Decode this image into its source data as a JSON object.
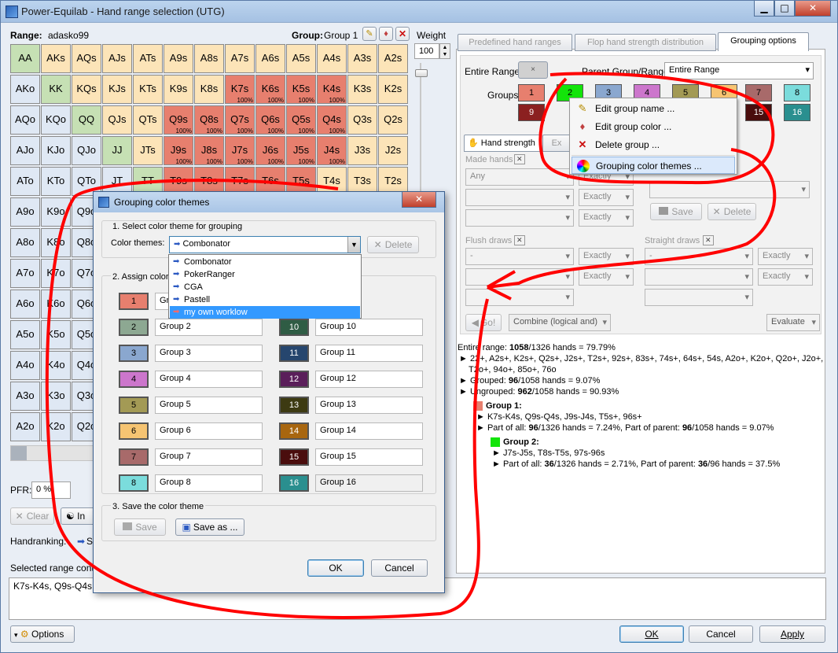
{
  "window": {
    "title": "Power-Equilab - Hand range selection (UTG)",
    "min": "▁",
    "max": "□",
    "close": "✕"
  },
  "range": {
    "label": "Range:",
    "name": "adasko99"
  },
  "group": {
    "label": "Group:",
    "name": "Group 1",
    "weight_label": "Weight",
    "weight_value": "100"
  },
  "grid": {
    "rows": [
      [
        {
          "t": "AA",
          "c": "#c6e0b4"
        },
        {
          "t": "AKs",
          "c": "#fce4b8"
        },
        {
          "t": "AQs",
          "c": "#fce4b8"
        },
        {
          "t": "AJs",
          "c": "#fce4b8"
        },
        {
          "t": "ATs",
          "c": "#fce4b8"
        },
        {
          "t": "A9s",
          "c": "#fce4b8"
        },
        {
          "t": "A8s",
          "c": "#fce4b8"
        },
        {
          "t": "A7s",
          "c": "#fce4b8"
        },
        {
          "t": "A6s",
          "c": "#fce4b8"
        },
        {
          "t": "A5s",
          "c": "#fce4b8"
        },
        {
          "t": "A4s",
          "c": "#fce4b8"
        },
        {
          "t": "A3s",
          "c": "#fce4b8"
        },
        {
          "t": "A2s",
          "c": "#fce4b8"
        }
      ],
      [
        {
          "t": "AKo",
          "c": "#dfe8f4"
        },
        {
          "t": "KK",
          "c": "#c6e0b4"
        },
        {
          "t": "KQs",
          "c": "#fce4b8"
        },
        {
          "t": "KJs",
          "c": "#fce4b8"
        },
        {
          "t": "KTs",
          "c": "#fce4b8"
        },
        {
          "t": "K9s",
          "c": "#fce4b8"
        },
        {
          "t": "K8s",
          "c": "#fce4b8"
        },
        {
          "t": "K7s",
          "c": "#e77f6e",
          "p": "100%"
        },
        {
          "t": "K6s",
          "c": "#e77f6e",
          "p": "100%"
        },
        {
          "t": "K5s",
          "c": "#e77f6e",
          "p": "100%"
        },
        {
          "t": "K4s",
          "c": "#e77f6e",
          "p": "100%"
        },
        {
          "t": "K3s",
          "c": "#fce4b8"
        },
        {
          "t": "K2s",
          "c": "#fce4b8"
        }
      ],
      [
        {
          "t": "AQo",
          "c": "#dfe8f4"
        },
        {
          "t": "KQo",
          "c": "#dfe8f4"
        },
        {
          "t": "QQ",
          "c": "#c6e0b4"
        },
        {
          "t": "QJs",
          "c": "#fce4b8"
        },
        {
          "t": "QTs",
          "c": "#fce4b8"
        },
        {
          "t": "Q9s",
          "c": "#e77f6e",
          "p": "100%"
        },
        {
          "t": "Q8s",
          "c": "#e77f6e",
          "p": "100%"
        },
        {
          "t": "Q7s",
          "c": "#e77f6e",
          "p": "100%"
        },
        {
          "t": "Q6s",
          "c": "#e77f6e",
          "p": "100%"
        },
        {
          "t": "Q5s",
          "c": "#e77f6e",
          "p": "100%"
        },
        {
          "t": "Q4s",
          "c": "#e77f6e",
          "p": "100%"
        },
        {
          "t": "Q3s",
          "c": "#fce4b8"
        },
        {
          "t": "Q2s",
          "c": "#fce4b8"
        }
      ],
      [
        {
          "t": "AJo",
          "c": "#dfe8f4"
        },
        {
          "t": "KJo",
          "c": "#dfe8f4"
        },
        {
          "t": "QJo",
          "c": "#dfe8f4"
        },
        {
          "t": "JJ",
          "c": "#c6e0b4"
        },
        {
          "t": "JTs",
          "c": "#fce4b8"
        },
        {
          "t": "J9s",
          "c": "#e77f6e",
          "p": "100%"
        },
        {
          "t": "J8s",
          "c": "#e77f6e",
          "p": "100%"
        },
        {
          "t": "J7s",
          "c": "#e77f6e",
          "p": "100%"
        },
        {
          "t": "J6s",
          "c": "#e77f6e",
          "p": "100%"
        },
        {
          "t": "J5s",
          "c": "#e77f6e",
          "p": "100%"
        },
        {
          "t": "J4s",
          "c": "#e77f6e",
          "p": "100%"
        },
        {
          "t": "J3s",
          "c": "#fce4b8"
        },
        {
          "t": "J2s",
          "c": "#fce4b8"
        }
      ],
      [
        {
          "t": "ATo",
          "c": "#dfe8f4"
        },
        {
          "t": "KTo",
          "c": "#dfe8f4"
        },
        {
          "t": "QTo",
          "c": "#dfe8f4"
        },
        {
          "t": "JT",
          "c": "#dfe8f4"
        },
        {
          "t": "TT",
          "c": "#c6e0b4"
        },
        {
          "t": "T9s",
          "c": "#e77f6e"
        },
        {
          "t": "T8s",
          "c": "#e77f6e"
        },
        {
          "t": "T7s",
          "c": "#e77f6e"
        },
        {
          "t": "T6s",
          "c": "#e77f6e"
        },
        {
          "t": "T5s",
          "c": "#e77f6e"
        },
        {
          "t": "T4s",
          "c": "#fce4b8"
        },
        {
          "t": "T3s",
          "c": "#fce4b8"
        },
        {
          "t": "T2s",
          "c": "#fce4b8"
        }
      ],
      [
        {
          "t": "A9o",
          "c": "#dfe8f4"
        },
        {
          "t": "K9o",
          "c": "#dfe8f4"
        },
        {
          "t": "Q9o",
          "c": "#dfe8f4"
        }
      ],
      [
        {
          "t": "A8o",
          "c": "#dfe8f4"
        },
        {
          "t": "K8o",
          "c": "#dfe8f4"
        },
        {
          "t": "Q8o",
          "c": "#dfe8f4"
        }
      ],
      [
        {
          "t": "A7o",
          "c": "#dfe8f4"
        },
        {
          "t": "K7o",
          "c": "#dfe8f4"
        },
        {
          "t": "Q7o",
          "c": "#dfe8f4"
        }
      ],
      [
        {
          "t": "A6o",
          "c": "#dfe8f4"
        },
        {
          "t": "K6o",
          "c": "#dfe8f4"
        },
        {
          "t": "Q6o",
          "c": "#dfe8f4"
        }
      ],
      [
        {
          "t": "A5o",
          "c": "#dfe8f4"
        },
        {
          "t": "K5o",
          "c": "#dfe8f4"
        },
        {
          "t": "Q5o",
          "c": "#dfe8f4"
        }
      ],
      [
        {
          "t": "A4o",
          "c": "#dfe8f4"
        },
        {
          "t": "K4o",
          "c": "#dfe8f4"
        },
        {
          "t": "Q4o",
          "c": "#dfe8f4"
        }
      ],
      [
        {
          "t": "A3o",
          "c": "#dfe8f4"
        },
        {
          "t": "K3o",
          "c": "#dfe8f4"
        },
        {
          "t": "Q3o",
          "c": "#dfe8f4"
        }
      ],
      [
        {
          "t": "A2o",
          "c": "#dfe8f4"
        },
        {
          "t": "K2o",
          "c": "#dfe8f4"
        },
        {
          "t": "Q2o",
          "c": "#dfe8f4"
        }
      ]
    ]
  },
  "left_bottom": {
    "pfr_label": "PFR:",
    "pfr_value": "0",
    "pfr_unit": "%",
    "clear": "Clear",
    "in": "In",
    "handranking": "Handranking:",
    "s": "S",
    "selected": "Selected range contai",
    "range_text": "K7s-K4s, Q9s-Q4s, J",
    "options": "Options"
  },
  "tabs": {
    "predefined": "Predefined hand ranges",
    "flop": "Flop hand strength distribution",
    "grouping": "Grouping options"
  },
  "grouping": {
    "entire_range_label": "Entire Range:",
    "entire_btn": "×",
    "parent_label": "Parent Group/Range:",
    "parent_value": "Entire Range",
    "groups_label": "Groups:",
    "buttons": [
      {
        "n": "1",
        "c": "#e77f6e"
      },
      {
        "n": "2",
        "c": "#13e40a"
      },
      {
        "n": "3",
        "c": "#8aa7cf"
      },
      {
        "n": "4",
        "c": "#cc76cc"
      },
      {
        "n": "5",
        "c": "#a39a55"
      },
      {
        "n": "6",
        "c": "#f6c472"
      },
      {
        "n": "7",
        "c": "#a86a6a"
      },
      {
        "n": "8",
        "c": "#7bdcdc"
      },
      {
        "n": "9",
        "c": "#8b2020"
      },
      {
        "n": "15",
        "c": "#4a0d0d"
      },
      {
        "n": "16",
        "c": "#2a8f8f"
      }
    ]
  },
  "menu": {
    "items": [
      "Edit group name ...",
      "Edit group color ...",
      "Delete group ...",
      "Grouping color themes ..."
    ]
  },
  "subtabs": {
    "hand_strength": "Hand strength",
    "ex": "Ex"
  },
  "filters": {
    "made_hands": "Made hands",
    "any": "Any",
    "exactly": "Exactly",
    "save": "Save",
    "delete": "Delete",
    "flush": "Flush draws",
    "straight": "Straight draws",
    "dash": "-",
    "go": "Go!",
    "combine": "Combine (logical and)",
    "evaluate": "Evaluate"
  },
  "info": {
    "l1a": "Entire range: ",
    "l1b": "1058",
    "l1c": "/1326 hands = 79.79%",
    "l2": "22+, A2s+, K2s+, Q2s+, J2s+, T2s+, 92s+, 83s+, 74s+, 64s+, 54s, A2o+, K2o+, Q2o+, J2o+,",
    "l3": "T2o+, 94o+, 85o+, 76o",
    "l4": "Grouped: ",
    "l4b": "96",
    "l4c": "/1058 hands = 9.07%",
    "l5": "Ungrouped: ",
    "l5b": "962",
    "l5c": "/1058 hands = 90.93%",
    "g1": "Group 1:",
    "g1r": "K7s-K4s, Q9s-Q4s, J9s-J4s, T5s+, 96s+",
    "g1p": "Part of all: ",
    "g1p2": "96",
    "g1p3": "/1326 hands = 7.24%, Part of parent: ",
    "g1p4": "96",
    "g1p5": "/1058 hands = 9.07%",
    "g2": "Group 2:",
    "g2r": "J7s-J5s, T8s-T5s, 97s-96s",
    "g2p": "Part of all: ",
    "g2p2": "36",
    "g2p3": "/1326 hands = 2.71%, Part of parent: ",
    "g2p4": "36",
    "g2p5": "/96 hands = 37.5%"
  },
  "bottom": {
    "ok": "OK",
    "cancel": "Cancel",
    "apply": "Apply"
  },
  "dialog": {
    "title": "Grouping color themes",
    "sec1": "1. Select color theme for grouping",
    "themes_label": "Color themes:",
    "current": "Combonator",
    "delete": "Delete",
    "sec2": "2. Assign colors",
    "themes": [
      "Combonator",
      "PokerRanger",
      "CGA",
      "Pastell",
      "my own worklow"
    ],
    "left": [
      {
        "n": "1",
        "c": "#e77f6e",
        "g": "Gro"
      },
      {
        "n": "2",
        "c": "#8da892",
        "g": "Group 2"
      },
      {
        "n": "3",
        "c": "#8aa7cf",
        "g": "Group 3"
      },
      {
        "n": "4",
        "c": "#cc76cc",
        "g": "Group 4"
      },
      {
        "n": "5",
        "c": "#a39a55",
        "g": "Group 5"
      },
      {
        "n": "6",
        "c": "#f6c472",
        "g": "Group 6"
      },
      {
        "n": "7",
        "c": "#a86a6a",
        "g": "Group 7"
      },
      {
        "n": "8",
        "c": "#7bdcdc",
        "g": "Group 8"
      }
    ],
    "right": [
      {
        "n": "10",
        "c": "#2f5c44",
        "g": "Group 10"
      },
      {
        "n": "11",
        "c": "#26466e",
        "g": "Group 11"
      },
      {
        "n": "12",
        "c": "#5a1e5a",
        "g": "Group 12"
      },
      {
        "n": "13",
        "c": "#3d3a12",
        "g": "Group 13"
      },
      {
        "n": "14",
        "c": "#a8660f",
        "g": "Group 14"
      },
      {
        "n": "15",
        "c": "#4a0d0d",
        "g": "Group 15"
      },
      {
        "n": "16",
        "c": "#2a8f8f",
        "g": "Group 16"
      }
    ],
    "sec3": "3. Save the color theme",
    "save": "Save",
    "save_as": "Save as ...",
    "ok": "OK",
    "cancel": "Cancel"
  }
}
